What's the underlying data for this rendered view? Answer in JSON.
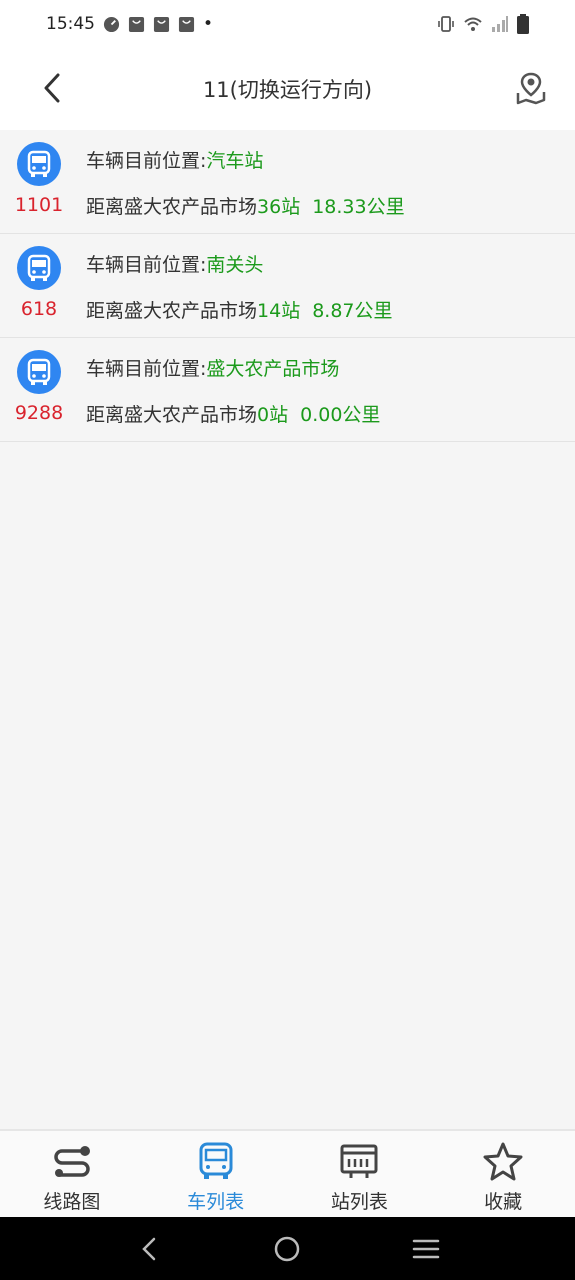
{
  "status_bar": {
    "time": "15:45",
    "dot": "•"
  },
  "header": {
    "title": "11(切换运行方向)"
  },
  "vehicles": [
    {
      "plate": "1101",
      "position_label": "车辆目前位置:",
      "position_value": "汽车站",
      "distance_label": "距离盛大农产品市场",
      "stops": "36站",
      "distance": "18.33公里"
    },
    {
      "plate": "618",
      "position_label": "车辆目前位置:",
      "position_value": "南关头",
      "distance_label": "距离盛大农产品市场",
      "stops": "14站",
      "distance": "8.87公里"
    },
    {
      "plate": "9288",
      "position_label": "车辆目前位置:",
      "position_value": "盛大农产品市场",
      "distance_label": "距离盛大农产品市场",
      "stops": "0站",
      "distance": "0.00公里"
    }
  ],
  "tabs": [
    {
      "label": "线路图",
      "icon": "route-map-icon",
      "active": false
    },
    {
      "label": "车列表",
      "icon": "bus-list-icon",
      "active": true
    },
    {
      "label": "站列表",
      "icon": "station-list-icon",
      "active": false
    },
    {
      "label": "收藏",
      "icon": "star-icon",
      "active": false
    }
  ],
  "colors": {
    "accent_blue": "#2f86f1",
    "active_tab": "#2a8ad8",
    "plate_red": "#d9232d",
    "value_green": "#1c9a1c"
  }
}
